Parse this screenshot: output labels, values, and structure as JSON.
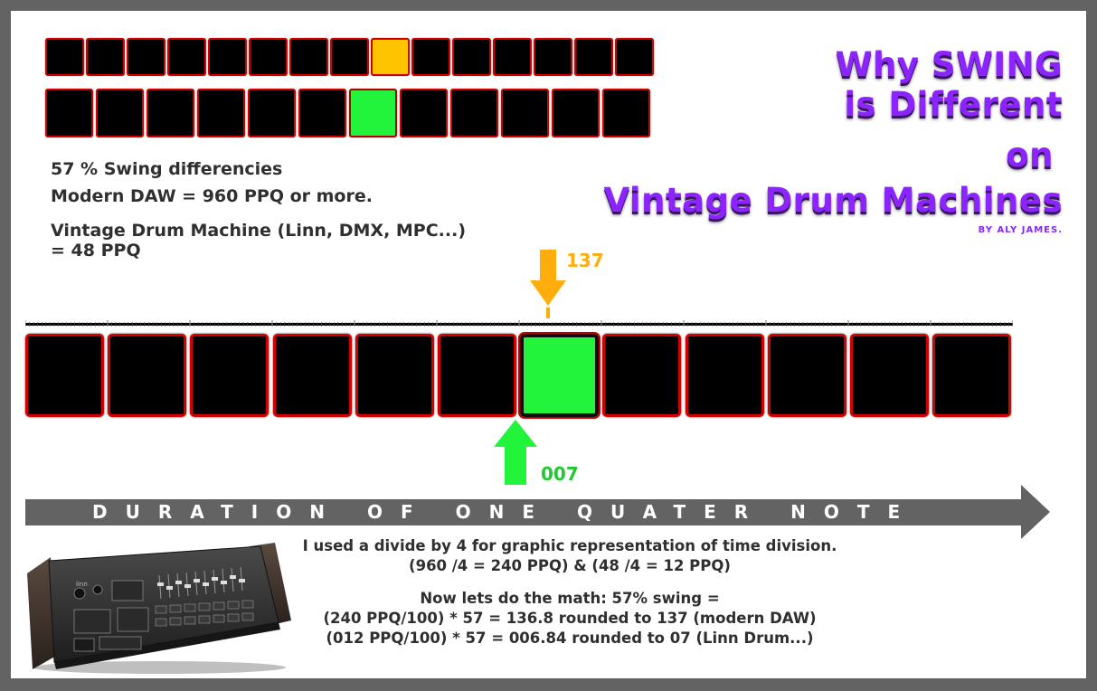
{
  "title": {
    "line1": "Why SWING",
    "line2": "is Different",
    "line3": "on",
    "line4": "Vintage Drum Machines",
    "byline": "BY ALY JAMES."
  },
  "info": {
    "line1": "57 % Swing differencies",
    "line2": "Modern DAW = 960 PPQ or more.",
    "line3": "Vintage Drum Machine (Linn, DMX, MPC...)",
    "line4": "= 48 PPQ"
  },
  "top_grid": {
    "steps": 15,
    "highlight_index": 8,
    "highlight_color": "#ffc400"
  },
  "middle_grid": {
    "steps": 12,
    "highlight_index": 6,
    "highlight_color": "#22f43c"
  },
  "main_grid": {
    "steps": 12,
    "highlight_index": 6,
    "highlight_color": "#22f43c"
  },
  "markers": {
    "daw": {
      "label": "137",
      "color": "#ffad0d"
    },
    "linn": {
      "label": "007",
      "color": "#22f43c"
    }
  },
  "axis": {
    "label": "DURATION OF ONE QUATER NOTE",
    "color": "#636363"
  },
  "notes": {
    "line1": "I used a divide by 4 for graphic representation of time division.",
    "line2": "(960 /4 = 240 PPQ) & (48 /4 = 12 PPQ)",
    "line3": "Now lets do the math: 57% swing =",
    "line4": "(240 PPQ/100) * 57 = 136.8 rounded to 137 (modern DAW)",
    "line5": "(012 PPQ/100) * 57 = 006.84 rounded to 07 (Linn Drum...)"
  },
  "colors": {
    "pad_border": "#d30000",
    "pad_fill": "#000000",
    "title": "#8b24ff",
    "frame": "#636363"
  }
}
